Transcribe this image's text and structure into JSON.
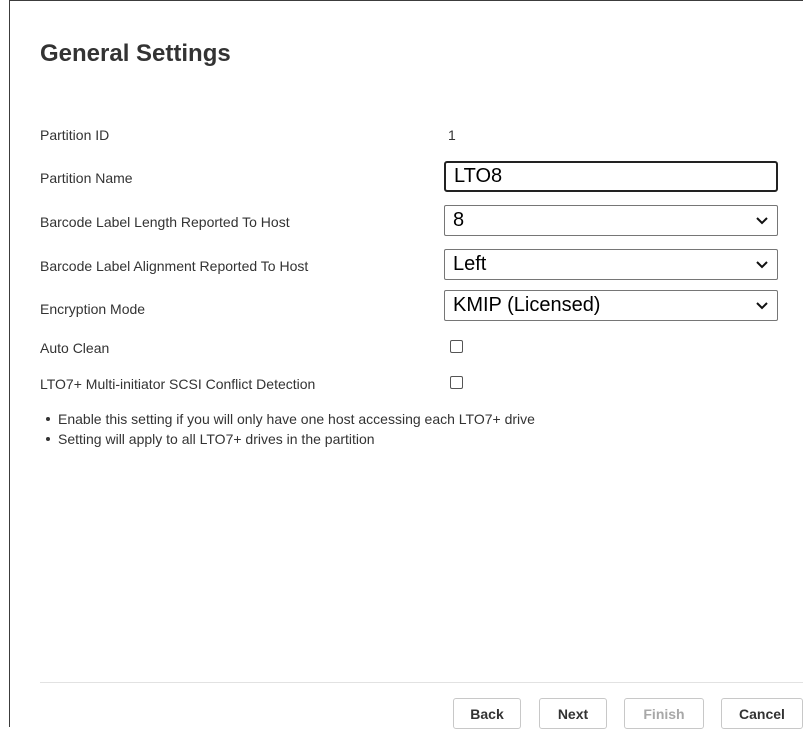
{
  "page": {
    "title": "General Settings"
  },
  "settings": {
    "partition_id": {
      "label": "Partition ID",
      "value": "1"
    },
    "partition_name": {
      "label": "Partition Name",
      "value": "LTO8"
    },
    "barcode_length": {
      "label": "Barcode Label Length Reported To Host",
      "value": "8"
    },
    "barcode_alignment": {
      "label": "Barcode Label Alignment Reported To Host",
      "value": "Left"
    },
    "encryption_mode": {
      "label": "Encryption Mode",
      "value": "KMIP (Licensed)"
    },
    "auto_clean": {
      "label": "Auto Clean",
      "checked": false
    },
    "conflict_detection": {
      "label": "LTO7+ Multi-initiator SCSI Conflict Detection",
      "checked": false
    }
  },
  "notes": [
    "Enable this setting if you will only have one host accessing each LTO7+ drive",
    "Setting will apply to all LTO7+ drives in the partition"
  ],
  "footer": {
    "back": "Back",
    "next": "Next",
    "finish": "Finish",
    "cancel": "Cancel"
  }
}
